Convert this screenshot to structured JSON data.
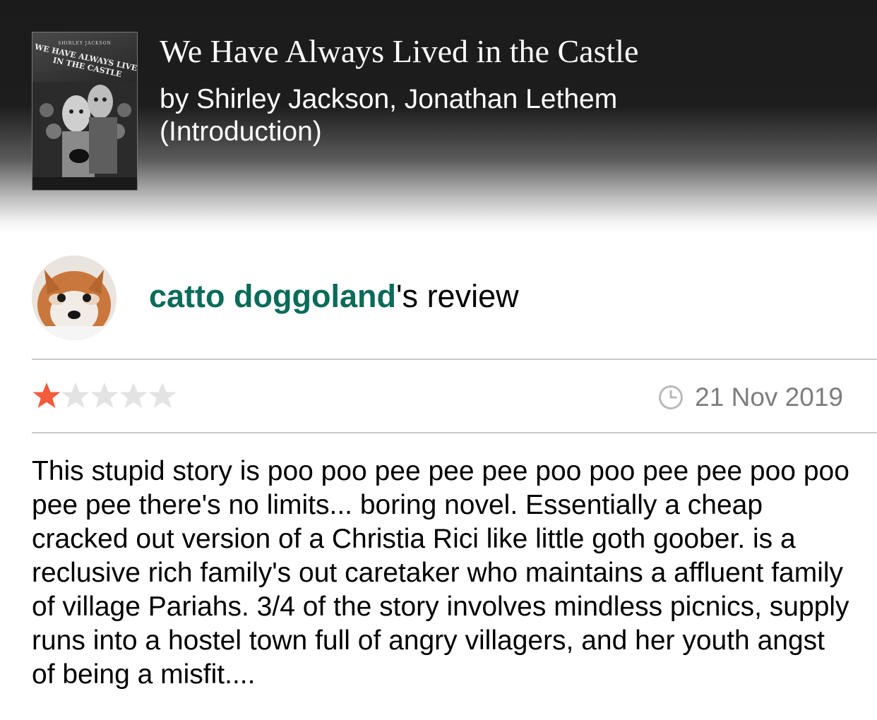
{
  "book": {
    "cover_author": "SHIRLEY JACKSON",
    "cover_title": "WE HAVE ALWAYS LIVED IN THE CASTLE",
    "title": "We Have Always Lived in the Castle",
    "author_line": "by Shirley Jackson, Jonathan Lethem (Introduction)"
  },
  "review": {
    "reviewer_name": "catto doggoland",
    "heading_suffix": "'s review",
    "rating": 1,
    "max_rating": 5,
    "date": "21 Nov 2019",
    "body": "This stupid story is poo poo pee pee pee poo poo pee pee poo poo pee pee there's no limits... boring novel. Essentially a cheap cracked out version of a Christia Rici like little goth goober. is a reclusive rich family's out caretaker who maintains a affluent family of village Pariahs. 3/4 of the story involves mindless picnics, supply runs into a hostel town full of angry villagers, and her youth angst of being a misfit...."
  },
  "colors": {
    "reviewer_name": "#0b6b5a",
    "star_filled": "#f25c3b",
    "star_empty": "#e3e3e3",
    "date_text": "#7d7d7d"
  },
  "icons": {
    "star": "star-icon",
    "clock": "clock-icon"
  }
}
